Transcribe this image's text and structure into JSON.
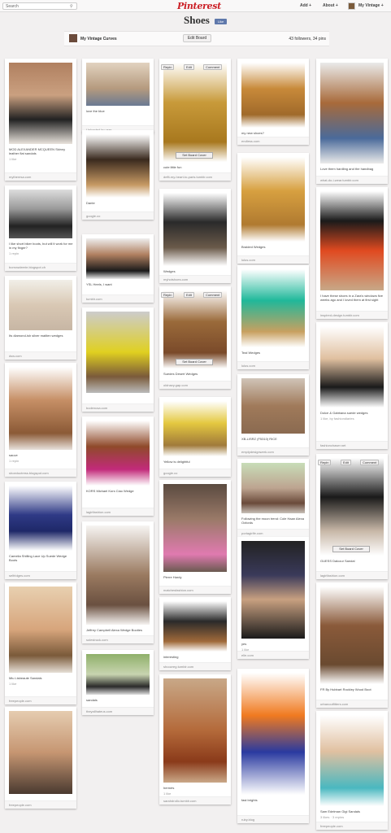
{
  "header": {
    "search_placeholder": "Search",
    "logo": "Pinterest",
    "add": "Add +",
    "about": "About +",
    "user": "My Vintage +"
  },
  "board": {
    "title": "Shoes",
    "like": "Like",
    "owner": "My Vintage Curves",
    "edit": "Edit Board",
    "stats": "43 followers, 34 pins"
  },
  "hover": {
    "repin": "Repin",
    "edit": "Edit",
    "comment": "Comment",
    "set_cover": "Set Board Cover"
  },
  "colors": {
    "brand": "#cb2027",
    "bg": "#f2f0f0"
  },
  "pins": [
    {
      "desc": "MOD ALEXANDER MCQUEEN Skinny leather flat sandals",
      "meta": "1 like",
      "src": "mytheresa.com"
    },
    {
      "desc": "I like short biker boots, but will it work for me in my finger?",
      "meta": "1 repin",
      "src": "borrowdeerie.blogspot.ch"
    },
    {
      "desc": "Its diamond-ish silver maitlen wedges",
      "meta": "",
      "src": "dsw.com"
    },
    {
      "desc": "sauve",
      "meta": "1 repin",
      "src": "shoeductress.blogspot.com"
    },
    {
      "desc": "Camelia Shilling Lace Up Suede Wedge Boots",
      "meta": "",
      "src": "selfridges.com"
    },
    {
      "desc": "Miu Lisbeaute Sandals",
      "meta": "1 like",
      "src": "freepeople.com"
    },
    {
      "desc": "",
      "meta": "",
      "src": "freepeople.com"
    },
    {
      "desc": "love the blue",
      "meta": "",
      "src": "Uploaded by user"
    },
    {
      "desc": "Dante",
      "meta": "",
      "src": "google.co"
    },
    {
      "desc": "YSL Heels, I want",
      "meta": "",
      "src": "tumblr.com"
    },
    {
      "desc": "",
      "meta": "",
      "src": "bodenusa.com"
    },
    {
      "desc": "KORS Michael Kors Ciao Wedge",
      "meta": "",
      "src": "lagirlfashion.com"
    },
    {
      "desc": "Jeffrey Campbell Alexa Wedge Booties",
      "meta": "",
      "src": "solestruck.com"
    },
    {
      "desc": "sandals",
      "meta": "",
      "src": "theyallhateus.com"
    },
    {
      "desc": "cute little fun",
      "meta": "",
      "src": "deflt-my-heart-to-paris.tumblr.com"
    },
    {
      "desc": "Wedges",
      "meta": "",
      "src": "myhotshoes.com"
    },
    {
      "desc": "Suedes Desert Wedges",
      "meta": "",
      "src": "oldnavy.gap.com"
    },
    {
      "desc": "Yellow is delightful",
      "meta": "",
      "src": "google.co"
    },
    {
      "desc": "Pierre Hardy",
      "meta": "",
      "src": "matchesfashion.com"
    },
    {
      "desc": "interesting",
      "meta": "",
      "src": "shoozreg.tumblr.com"
    },
    {
      "desc": "hermès",
      "meta": "1 like",
      "src": "sarahdrollo.tumblr.com"
    },
    {
      "desc": "my new shoes?",
      "meta": "",
      "src": "endless.com"
    },
    {
      "desc": "Braided Wedges",
      "meta": "",
      "src": "lulus.com"
    },
    {
      "desc": "Teal Wedges",
      "meta": "",
      "src": "lulus.com"
    },
    {
      "desc": "XB-LISRZ (F5310) RICE",
      "meta": "",
      "src": "emptydesignwerk.com"
    },
    {
      "desc": "Following the moon trend: Cole Haan Alexa Oxfords",
      "meta": "",
      "src": "portagirlfe.com"
    },
    {
      "desc": "yes",
      "meta": "1 like",
      "src": "elle.com"
    },
    {
      "desc": "fast brights",
      "meta": "",
      "src": "ruby.blog"
    },
    {
      "desc": "Love them hardling and the handbag",
      "meta": "",
      "src": "what-do-i-wear.tumblr.com"
    },
    {
      "desc": "I have these shoes in a Zara's windows five weeks ago and I loved them at first sight",
      "meta": "",
      "src": "inspired-design.tumblr.com"
    },
    {
      "desc": "Dolce & Gabbana suede wedges",
      "meta": "1 like, by fashiondiaries",
      "src": "fashionchaser.net"
    },
    {
      "desc": "GUESS Dalcour Sandal",
      "meta": "",
      "src": "lagirlfashion.com"
    },
    {
      "desc": "FR By Hubbart Rockley Wood Boot",
      "meta": "",
      "src": "urbanoutfitters.com"
    },
    {
      "desc": "Sam Edelman Gigi Sandals",
      "meta": "3 likes · 3 repins",
      "src": "freepeople.com"
    }
  ]
}
